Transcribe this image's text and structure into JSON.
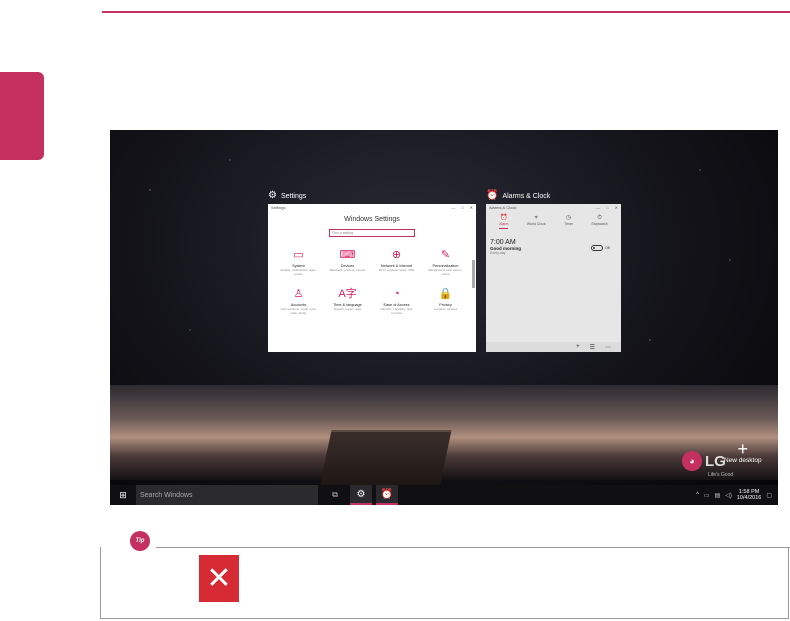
{
  "screen": {
    "settings_window": {
      "caption": "Settings",
      "titlebar": "Settings",
      "heading": "Windows Settings",
      "search_placeholder": "Find a setting",
      "tiles": [
        {
          "icon": "laptop-icon",
          "glyph": "▭",
          "name": "System",
          "desc": "Display, notifications, apps, power"
        },
        {
          "icon": "devices-icon",
          "glyph": "⌨",
          "name": "Devices",
          "desc": "Bluetooth, printers, mouse"
        },
        {
          "icon": "globe-icon",
          "glyph": "⊕",
          "name": "Network & Internet",
          "desc": "Wi-Fi, airplane mode, VPN"
        },
        {
          "icon": "personalization-icon",
          "glyph": "✎",
          "name": "Personalization",
          "desc": "Background, lock screen, colors"
        },
        {
          "icon": "person-icon",
          "glyph": "♙",
          "name": "Accounts",
          "desc": "Your accounts, email, sync, work, family"
        },
        {
          "icon": "time-language-icon",
          "glyph": "A字",
          "name": "Time & language",
          "desc": "Speech, region, date"
        },
        {
          "icon": "ease-of-access-icon",
          "glyph": "◔",
          "name": "Ease of Access",
          "desc": "Narrator, magnifier, high contrast"
        },
        {
          "icon": "lock-icon",
          "glyph": "🔒",
          "name": "Privacy",
          "desc": "Location, camera"
        }
      ]
    },
    "alarm_window": {
      "caption": "Alarms & Clock",
      "titlebar": "Alarms & Clock",
      "tabs": [
        {
          "label": "Alarm",
          "glyph": "⏰"
        },
        {
          "label": "World Clock",
          "glyph": "⌖"
        },
        {
          "label": "Timer",
          "glyph": "◷"
        },
        {
          "label": "Stopwatch",
          "glyph": "⏱"
        }
      ],
      "alarm": {
        "time": "7:00 AM",
        "name": "Good morning",
        "repeat": "Every day",
        "toggle_label": "Off"
      }
    },
    "new_desktop_label": "New desktop",
    "logo_text": "LG",
    "logo_tagline": "Life's Good",
    "taskbar": {
      "search_placeholder": "Search Windows",
      "clock_time": "1:58 PM",
      "clock_date": "10/4/2016"
    }
  },
  "tip": {
    "badge": "Tip"
  },
  "colors": {
    "accent": "#c4305f",
    "close_red": "#d62b34"
  }
}
